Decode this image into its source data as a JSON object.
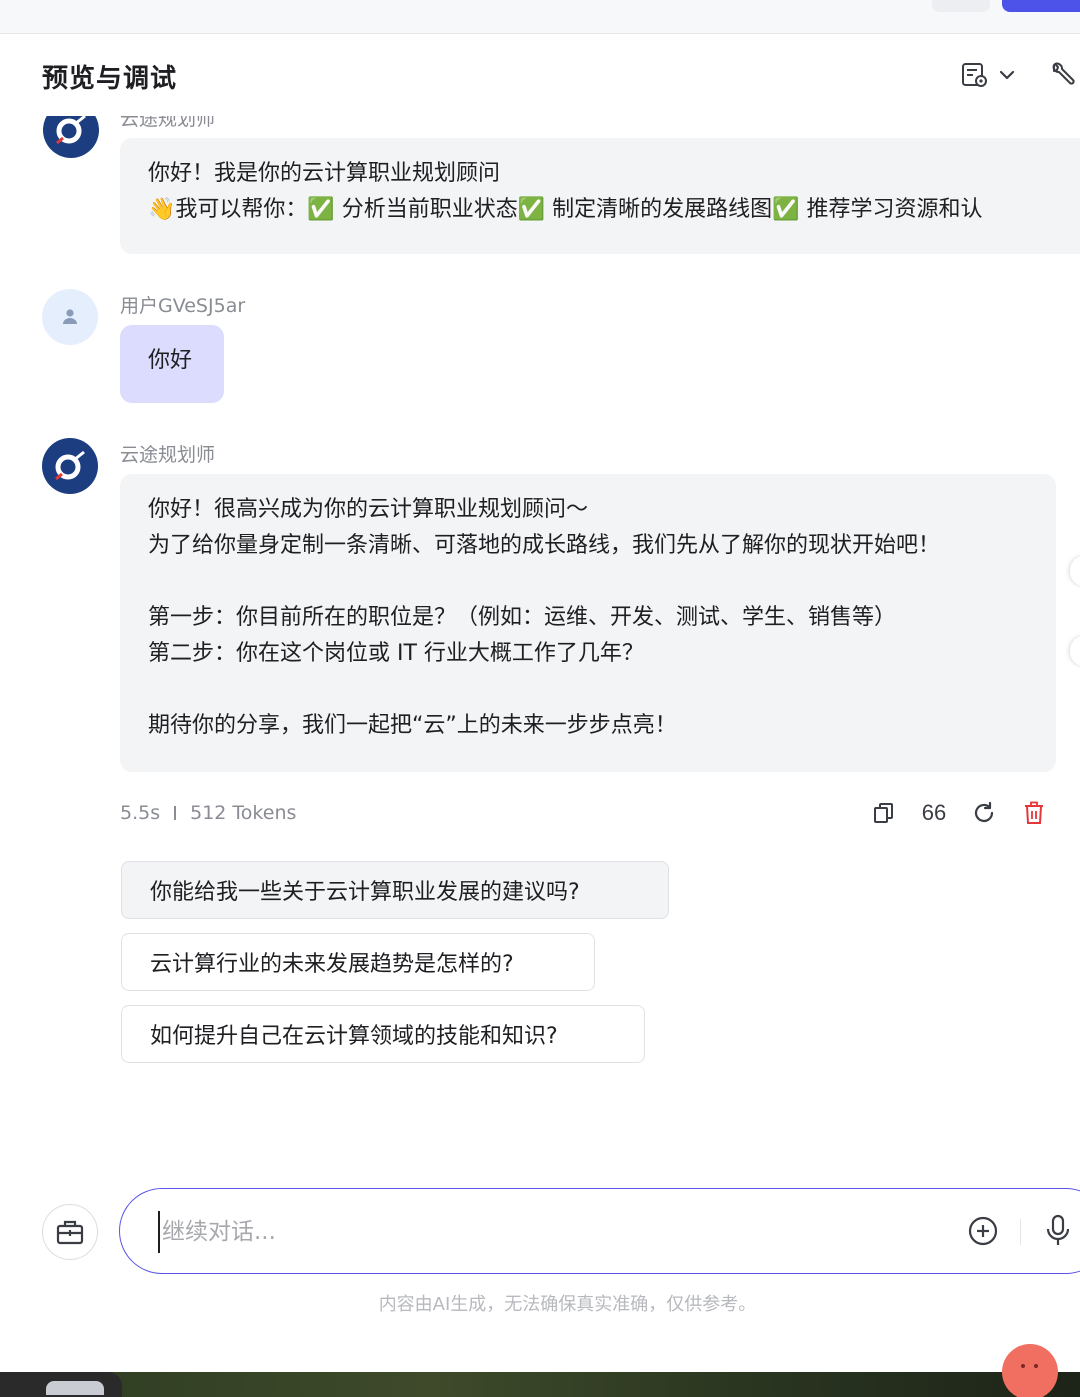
{
  "header": {
    "title": "预览与调试",
    "mode_icon": "layout-settings-icon",
    "tool_icon": "wrench-icon"
  },
  "messages": [
    {
      "role": "bot",
      "sender": "云途规划师",
      "lines": [
        "你好！我是你的云计算职业规划顾问",
        "👋我可以帮你：✅ 分析当前职业状态✅ 制定清晰的发展路线图✅ 推荐学习资源和认"
      ]
    },
    {
      "role": "user",
      "sender": "用户GVeSJ5ar",
      "text": "你好"
    },
    {
      "role": "bot",
      "sender": "云途规划师",
      "lines": [
        "你好！很高兴成为你的云计算职业规划顾问～",
        "为了给你量身定制一条清晰、可落地的成长路线，我们先从了解你的现状开始吧！",
        "",
        "第一步：你目前所在的职位是？（例如：运维、开发、测试、学生、销售等）",
        "第二步：你在这个岗位或 IT 行业大概工作了几年？",
        "",
        "期待你的分享，我们一起把“云”上的未来一步步点亮！"
      ]
    }
  ],
  "meta": {
    "time": "5.5s",
    "tokens": "512 Tokens"
  },
  "actions": {
    "copy_icon": "copy-icon",
    "quote_icon": "quote-icon",
    "quote_glyph": "66",
    "regenerate_icon": "refresh-icon",
    "delete_icon": "trash-icon"
  },
  "suggestions": [
    "你能给我一些关于云计算职业发展的建议吗?",
    "云计算行业的未来发展趋势是怎样的?",
    "如何提升自己在云计算领域的技能和知识?"
  ],
  "input": {
    "placeholder": "继续对话...",
    "value": ""
  },
  "disclaimer": "内容由AI生成，无法确保真实准确，仅供参考。",
  "colors": {
    "accent": "#4d53e8",
    "user_bubble": "#dcdcff",
    "bot_bubble": "#f3f4f6",
    "delete": "#e5373a",
    "bot_avatar": "#1c3d80"
  }
}
